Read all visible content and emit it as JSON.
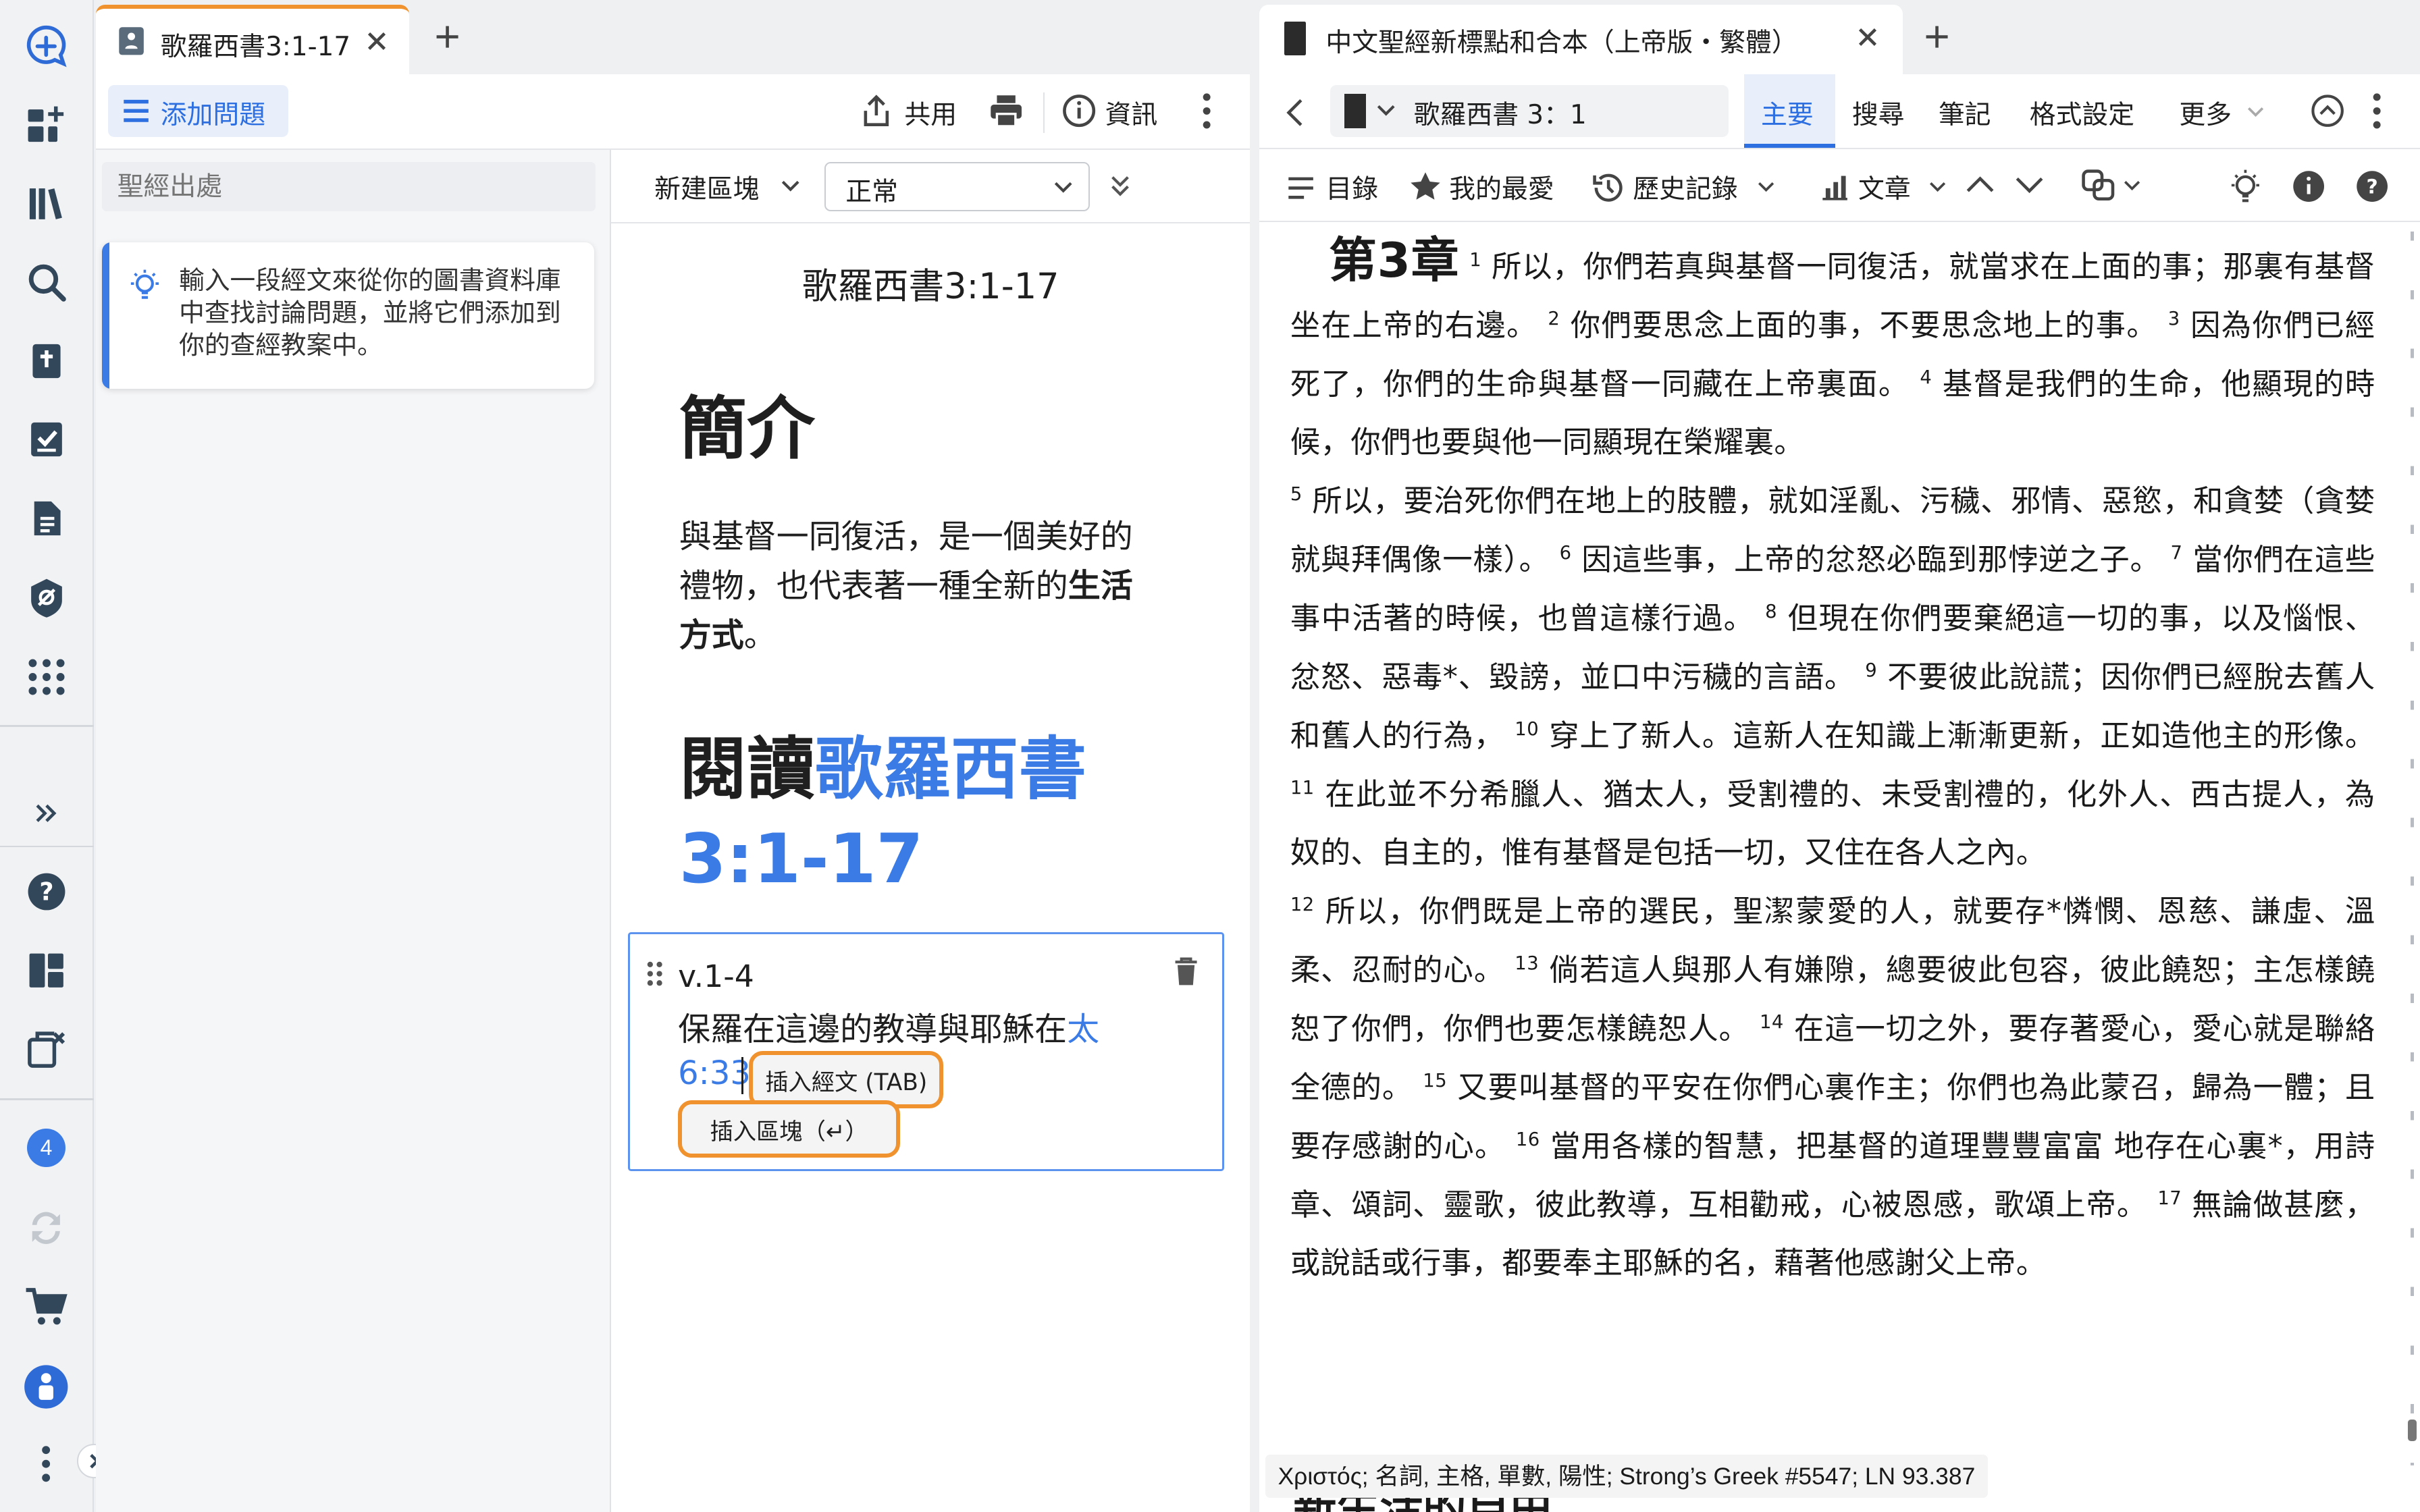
{
  "rail": {
    "notifications_count": "4"
  },
  "left_panel": {
    "tab_title": "歌羅西書3:1-17",
    "toolbar": {
      "add_question": "添加問題",
      "share": "共用",
      "info": "資訊"
    },
    "search_placeholder": "聖經出處",
    "tip_text": "輸入一段經文來從你的圖書資料庫中查找討論問題，並將它們添加到你的查經教案中。",
    "editor": {
      "new_block": "新建區塊",
      "style_value": "正常",
      "doc_title": "歌羅西書3:1-17",
      "intro_heading": "簡介",
      "intro_text": "與基督一同復活，是一個美好的禮物，也代表著一種全新的",
      "intro_bold": "生活方式",
      "intro_end": "。",
      "read_prefix": "閱讀",
      "read_link_1": "歌羅西書",
      "read_link_2": "3:1-17",
      "block_label": "v.1-4",
      "block_text": "保羅在這邊的教導與耶穌在",
      "block_link_1": "太",
      "block_link_2": "6:33",
      "insert_verse": "插入經文 (TAB)",
      "insert_block": "插入區塊（↵）"
    }
  },
  "right_panel": {
    "tab_title": "中文聖經新標點和合本（上帝版・繁體）",
    "reference": "歌羅西書 3：1",
    "tabs": [
      "主要",
      "搜尋",
      "筆記",
      "格式設定",
      "更多"
    ],
    "toolbar": {
      "toc": "目錄",
      "favorites": "我的最愛",
      "history": "歷史記錄",
      "text": "文章"
    },
    "chapter_label": "第3章",
    "verses": [
      {
        "n": "1",
        "t": "所以，你們若真與基督一同復活，就當求在上面的事；那裏有基督 坐在上帝的右邊。"
      },
      {
        "n": "2",
        "t": "你們要思念上面的事，不要思念地上的事。"
      },
      {
        "n": "3",
        "t": "因為你們已經死了，你們的生命與基督一同藏在上帝裏面。"
      },
      {
        "n": "4",
        "t": "基督是我們的生命，他顯現的時候，你們也要與他一同顯現在榮耀裏。"
      },
      {
        "n": "5",
        "t": "所以，要治死你們在地上的肢體，就如淫亂、污穢、邪情、惡慾，和貪婪（貪婪就與拜偶像一樣）。"
      },
      {
        "n": "6",
        "t": "因這些事，上帝的忿怒必臨到那悖逆之子。"
      },
      {
        "n": "7",
        "t": "當你們在這些事中活著的時候，也曾這樣行過。"
      },
      {
        "n": "8",
        "t": "但現在你們要棄絕這一切的事，以及惱恨、忿怒、惡毒*、毀謗，並口中污穢的言語。"
      },
      {
        "n": "9",
        "t": "不要彼此說謊；因你們已經脫去舊人和舊人的行為，"
      },
      {
        "n": "10",
        "t": "穿上了新人。這新人在知識上漸漸更新，正如造他主的形像。"
      },
      {
        "n": "11",
        "t": "在此並不分希臘人、猶太人，受割禮的、未受割禮的，化外人、西古提人，為奴的、自主的，惟有基督是包括一切，又住在各人之內。"
      },
      {
        "n": "12",
        "t": "所以，你們既是上帝的選民，聖潔蒙愛的人，就要存*憐憫、恩慈、謙虛、溫柔、忍耐的心。"
      },
      {
        "n": "13",
        "t": "倘若這人與那人有嫌隙，總要彼此包容，彼此饒恕；主怎樣饒恕了你們，你們也要怎樣饒恕人。"
      },
      {
        "n": "14",
        "t": "在這一切之外，要存著愛心，愛心就是聯絡全德的。"
      },
      {
        "n": "15",
        "t": "又要叫基督的平安在你們心裏作主；你們也為此蒙召，歸為一體；且要存感謝的心。"
      },
      {
        "n": "16",
        "t": "當用各樣的智慧，把基督的道理豐豐富富 地存在心裏*，用詩章、頌詞、靈歌，彼此教導，互相勸戒，心被恩感，歌頌上帝。"
      },
      {
        "n": "17",
        "t": "無論做甚麼，或說話或行事，都要奉主耶穌的名，藉著他感謝父上帝。"
      }
    ],
    "status_text": "Χριστός; 名詞, 主格, 單數, 陽性; Strong’s Greek #5547; LN 93.387",
    "partial_heading": "新生活的自由"
  },
  "colors": {
    "accent": "#2d6fe0",
    "link": "#3b7be6",
    "highlight": "#f0922e",
    "rail_bg": "#f1f2f4",
    "badge": "#3b7be6"
  }
}
